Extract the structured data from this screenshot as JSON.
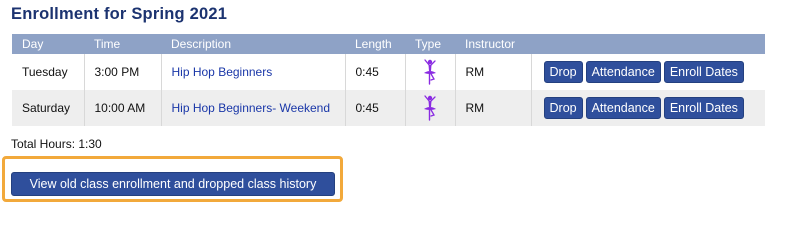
{
  "page": {
    "title": "Enrollment for Spring 2021"
  },
  "table": {
    "headers": [
      "Day",
      "Time",
      "Description",
      "Length",
      "Type",
      "Instructor"
    ],
    "rows": [
      {
        "day": "Tuesday",
        "time": "3:00 PM",
        "description": "Hip Hop Beginners",
        "length": "0:45",
        "type_icon": "dancer-icon",
        "instructor": "RM",
        "actions": [
          "Drop",
          "Attendance",
          "Enroll Dates"
        ]
      },
      {
        "day": "Saturday",
        "time": "10:00 AM",
        "description": "Hip Hop Beginners- Weekend",
        "length": "0:45",
        "type_icon": "dancer-icon",
        "instructor": "RM",
        "actions": [
          "Drop",
          "Attendance",
          "Enroll Dates"
        ]
      }
    ]
  },
  "summary": {
    "total_hours": "Total Hours: 1:30"
  },
  "history_button": {
    "label": "View old class enrollment and dropped class history"
  },
  "colors": {
    "header_bg": "#8ea2c6",
    "button_bg": "#2f4f9c",
    "title": "#1c3370",
    "link": "#1a37a8",
    "highlight": "#f2a93b",
    "dancer_icon": "#8a2be2"
  }
}
